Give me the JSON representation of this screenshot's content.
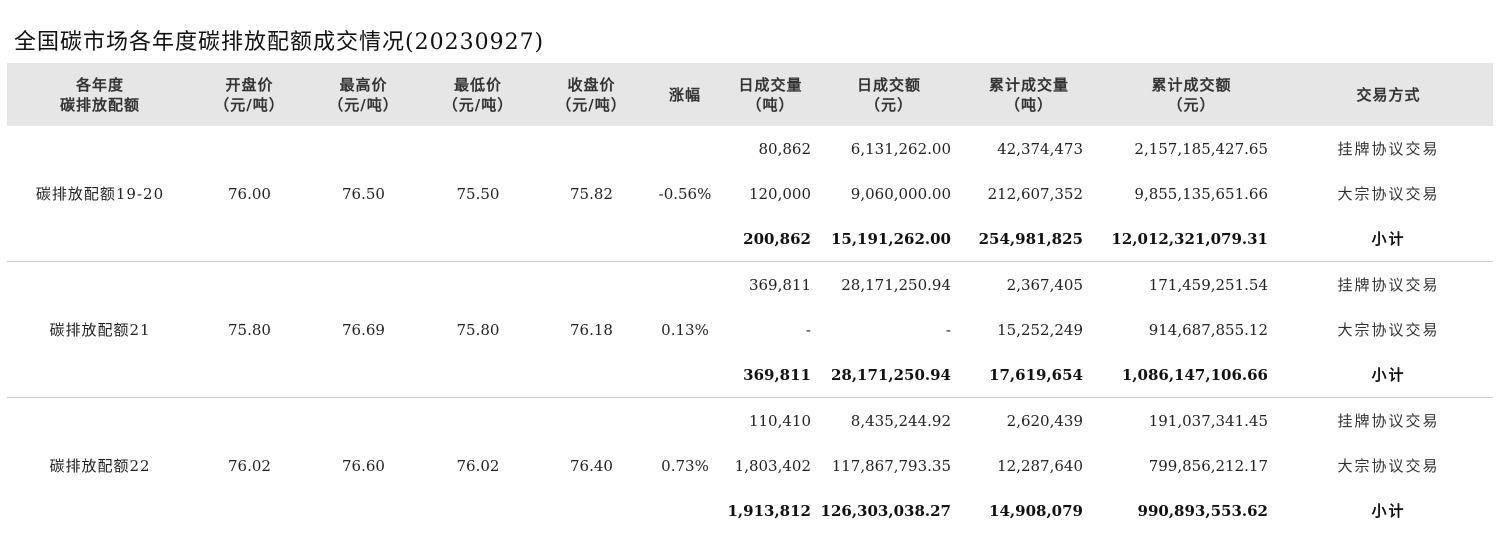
{
  "title": "全国碳市场各年度碳排放配额成交情况(20230927)",
  "headers": [
    {
      "l1": "各年度",
      "l2": "碳排放配额"
    },
    {
      "l1": "开盘价",
      "l2": "（元/吨）"
    },
    {
      "l1": "最高价",
      "l2": "（元/吨）"
    },
    {
      "l1": "最低价",
      "l2": "（元/吨）"
    },
    {
      "l1": "收盘价",
      "l2": "（元/吨）"
    },
    {
      "l1": "涨幅",
      "l2": ""
    },
    {
      "l1": "日成交量",
      "l2": "（吨）"
    },
    {
      "l1": "日成交额",
      "l2": "（元）"
    },
    {
      "l1": "累计成交量",
      "l2": "（吨）"
    },
    {
      "l1": "累计成交额",
      "l2": "（元）"
    },
    {
      "l1": "交易方式",
      "l2": ""
    }
  ],
  "groups": [
    {
      "name": "碳排放配额19-20",
      "open": "76.00",
      "high": "76.50",
      "low": "75.50",
      "close": "75.82",
      "change": "-0.56%",
      "rows": [
        {
          "vol": "80,862",
          "amt": "6,131,262.00",
          "cum_vol": "42,374,473",
          "cum_amt": "2,157,185,427.65",
          "mode": "挂牌协议交易"
        },
        {
          "vol": "120,000",
          "amt": "9,060,000.00",
          "cum_vol": "212,607,352",
          "cum_amt": "9,855,135,651.66",
          "mode": "大宗协议交易"
        },
        {
          "vol": "200,862",
          "amt": "15,191,262.00",
          "cum_vol": "254,981,825",
          "cum_amt": "12,012,321,079.31",
          "mode": "小计"
        }
      ]
    },
    {
      "name": "碳排放配额21",
      "open": "75.80",
      "high": "76.69",
      "low": "75.80",
      "close": "76.18",
      "change": "0.13%",
      "rows": [
        {
          "vol": "369,811",
          "amt": "28,171,250.94",
          "cum_vol": "2,367,405",
          "cum_amt": "171,459,251.54",
          "mode": "挂牌协议交易"
        },
        {
          "vol": "-",
          "amt": "-",
          "cum_vol": "15,252,249",
          "cum_amt": "914,687,855.12",
          "mode": "大宗协议交易"
        },
        {
          "vol": "369,811",
          "amt": "28,171,250.94",
          "cum_vol": "17,619,654",
          "cum_amt": "1,086,147,106.66",
          "mode": "小计"
        }
      ]
    },
    {
      "name": "碳排放配额22",
      "open": "76.02",
      "high": "76.60",
      "low": "76.02",
      "close": "76.40",
      "change": "0.73%",
      "rows": [
        {
          "vol": "110,410",
          "amt": "8,435,244.92",
          "cum_vol": "2,620,439",
          "cum_amt": "191,037,341.45",
          "mode": "挂牌协议交易"
        },
        {
          "vol": "1,803,402",
          "amt": "117,867,793.35",
          "cum_vol": "12,287,640",
          "cum_amt": "799,856,212.17",
          "mode": "大宗协议交易"
        },
        {
          "vol": "1,913,812",
          "amt": "126,303,038.27",
          "cum_vol": "14,908,079",
          "cum_amt": "990,893,553.62",
          "mode": "小计"
        }
      ]
    }
  ]
}
